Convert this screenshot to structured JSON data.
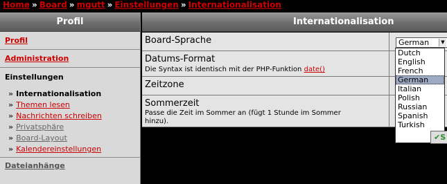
{
  "breadcrumb": {
    "items": [
      "Home",
      "Board",
      "mgutt",
      "Einstellungen",
      "Internationalisation"
    ],
    "sep": "»"
  },
  "sidebar": {
    "title": "Profil",
    "profil": "Profil",
    "administration": "Administration",
    "einstellungen": "Einstellungen",
    "sub": [
      {
        "label": "Internationalisation",
        "active": true
      },
      {
        "label": "Themen lesen"
      },
      {
        "label": "Nachrichten schreiben"
      },
      {
        "label": "Privatsphäre"
      },
      {
        "label": "Board-Layout"
      },
      {
        "label": "Kalendereinstellungen"
      }
    ],
    "dateianhaenge": "Dateianhänge"
  },
  "main": {
    "title": "Internationalisation",
    "rows": [
      {
        "label": "Board-Sprache"
      },
      {
        "label": "Datums-Format",
        "desc": "Die Syntax ist identisch mit der PHP-Funktion",
        "link": "date()"
      },
      {
        "label": "Zeitzone"
      },
      {
        "label": "Sommerzeit",
        "desc": "Passe die Zeit im Sommer an (fügt 1 Stunde im Sommer hinzu)."
      }
    ],
    "language_select": {
      "value": "German",
      "options": [
        "Dutch",
        "English",
        "French",
        "German",
        "Italian",
        "Polish",
        "Russian",
        "Spanish",
        "Turkish"
      ],
      "selected": "German"
    },
    "submit_visible": "S"
  }
}
